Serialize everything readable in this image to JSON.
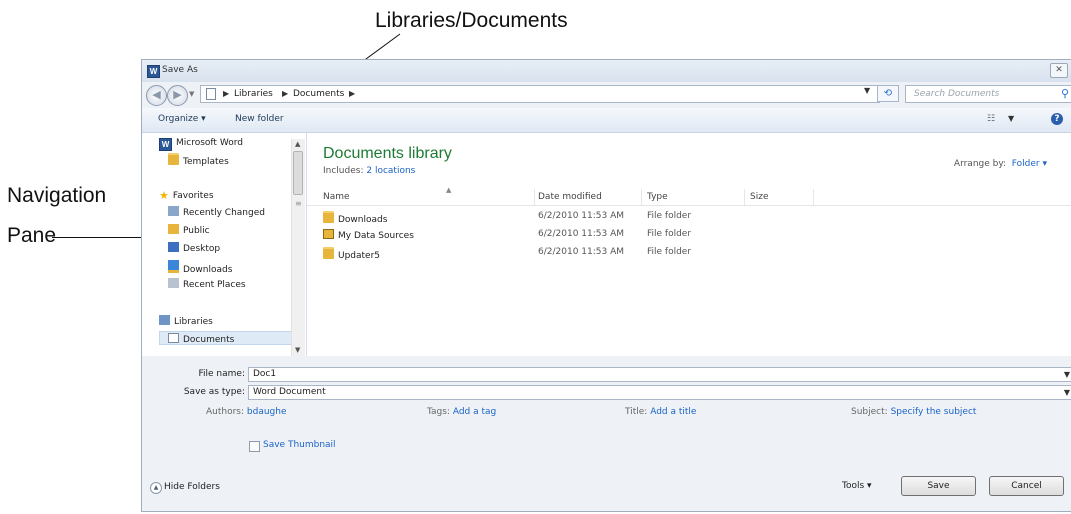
{
  "annotations": {
    "top": "Libraries/Documents",
    "nav_line1": "Navigation",
    "nav_line2": "Pane"
  },
  "window": {
    "title": "Save As",
    "app_icon": "W",
    "close_glyph": "✕"
  },
  "address_bar": {
    "crumbs": [
      "Libraries",
      "Documents"
    ],
    "search_placeholder": "Search Documents"
  },
  "toolbar": {
    "organize": "Organize ▾",
    "new_folder": "New folder"
  },
  "nav_pane": {
    "items": [
      {
        "label": "Microsoft Word",
        "icon": "word-icon"
      },
      {
        "label": "Templates",
        "icon": "folder-icon"
      },
      {
        "label": "Favorites",
        "icon": "star-icon"
      },
      {
        "label": "Recently Changed",
        "icon": "recent-icon"
      },
      {
        "label": "Public",
        "icon": "folder-icon"
      },
      {
        "label": "Desktop",
        "icon": "desktop-icon"
      },
      {
        "label": "Downloads",
        "icon": "downloads-icon"
      },
      {
        "label": "Recent Places",
        "icon": "recent-places-icon"
      },
      {
        "label": "Libraries",
        "icon": "libraries-icon"
      },
      {
        "label": "Documents",
        "icon": "document-icon",
        "selected": true
      }
    ]
  },
  "library": {
    "title": "Documents library",
    "includes_label": "Includes:",
    "includes_value": "2 locations",
    "arrange_label": "Arrange by:",
    "arrange_value": "Folder ▾"
  },
  "columns": [
    "Name",
    "Date modified",
    "Type",
    "Size"
  ],
  "files": [
    {
      "name": "Downloads",
      "date": "6/2/2010 11:53 AM",
      "type": "File folder",
      "icon": "folder-icon"
    },
    {
      "name": "My Data Sources",
      "date": "6/2/2010 11:53 AM",
      "type": "File folder",
      "icon": "data-sources-folder-icon"
    },
    {
      "name": "Updater5",
      "date": "6/2/2010 11:53 AM",
      "type": "File folder",
      "icon": "folder-icon"
    }
  ],
  "form": {
    "file_name_label": "File name:",
    "file_name_value": "Doc1",
    "save_type_label": "Save as type:",
    "save_type_value": "Word Document",
    "authors_label": "Authors:",
    "authors_value": "bdaughe",
    "tags_label": "Tags:",
    "tags_value": "Add a tag",
    "title_label": "Title:",
    "title_value": "Add a title",
    "subject_label": "Subject:",
    "subject_value": "Specify the subject",
    "thumbnail_label": "Save Thumbnail"
  },
  "footer": {
    "hide_folders": "Hide Folders",
    "tools": "Tools ▾",
    "save": "Save",
    "cancel": "Cancel"
  }
}
